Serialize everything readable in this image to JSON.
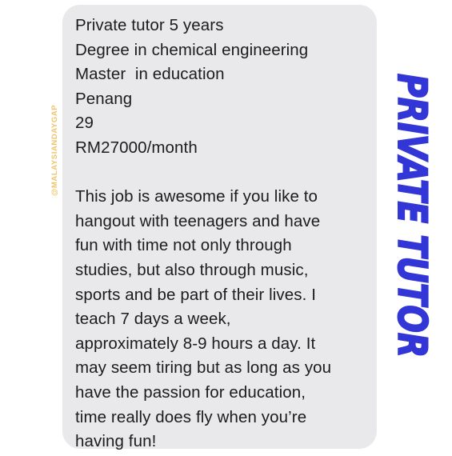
{
  "message": {
    "info_lines": [
      "Private tutor 5 years",
      "Degree in chemical engineering",
      "Master  in education",
      "Penang",
      "29",
      "RM27000/month"
    ],
    "story_lines": [
      "This job is awesome if you like to",
      "hangout with teenagers and have",
      "fun with time not only through",
      "studies, but also through music,",
      "sports and be part of their lives. I",
      "teach 7 days a week,",
      "approximately 8-9 hours a day. It",
      "may seem tiring but as long as you",
      "have the passion for education,",
      "time really does fly when you’re",
      "having fun!"
    ]
  },
  "watermark": "@MALAYSIANDAYGAP",
  "stamp_title": "PRIVATE TUTOR",
  "colors": {
    "bubble_bg": "#e9e9eb",
    "stamp_blue": "#3336d6",
    "watermark": "#f1c46a"
  }
}
